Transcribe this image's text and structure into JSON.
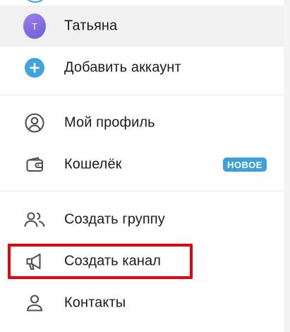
{
  "account": {
    "name": "Татьяна",
    "initial": "Т"
  },
  "add_account": {
    "label": "Добавить аккаунт"
  },
  "menu": {
    "profile": "Мой профиль",
    "wallet": "Кошелёк",
    "wallet_badge": "НОВОЕ",
    "new_group": "Создать группу",
    "new_channel": "Создать канал",
    "contacts": "Контакты"
  },
  "colors": {
    "accent": "#3ba0dc",
    "highlight": "#e8000c",
    "avatar": "#7b68e0"
  },
  "icons": [
    "plus-circle-icon",
    "user-circle-icon",
    "wallet-icon",
    "people-icon",
    "megaphone-icon",
    "person-icon"
  ]
}
